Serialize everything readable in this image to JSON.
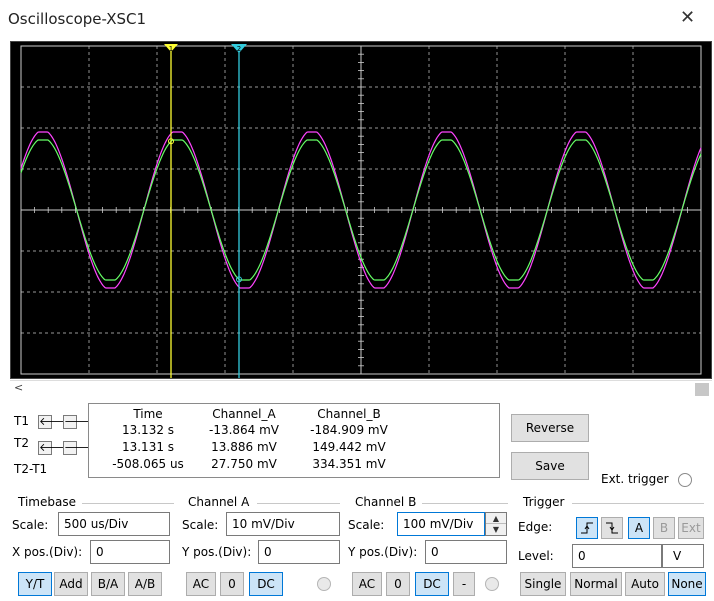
{
  "window": {
    "title": "Oscilloscope-XSC1",
    "close_glyph": "✕"
  },
  "cursors": {
    "t1_color": "#ffff33",
    "t2_color": "#33ccdd"
  },
  "traces": {
    "channel_a_color": "#66ff66",
    "channel_b_color": "#ff44ff",
    "grid_color": "#cccccc"
  },
  "scroll": {
    "left_glyph": "<"
  },
  "measurements": {
    "row_labels": [
      "T1",
      "T2",
      "T2-T1"
    ],
    "headers": [
      "Time",
      "Channel_A",
      "Channel_B"
    ],
    "rows": [
      [
        "13.132 s",
        "-13.864 mV",
        "-184.909 mV"
      ],
      [
        "13.131 s",
        "13.886 mV",
        "149.442 mV"
      ],
      [
        "-508.065 us",
        "27.750 mV",
        "334.351 mV"
      ]
    ],
    "arrow_left": "🡐",
    "arrow_right": "🡒"
  },
  "side_buttons": {
    "reverse": "Reverse",
    "save": "Save",
    "ext_trigger": "Ext. trigger"
  },
  "timebase": {
    "title": "Timebase",
    "scale_label": "Scale:",
    "scale_value": "500 us/Div",
    "xpos_label": "X pos.(Div):",
    "xpos_value": "0",
    "modes": [
      "Y/T",
      "Add",
      "B/A",
      "A/B"
    ]
  },
  "channel_a": {
    "title": "Channel A",
    "scale_label": "Scale:",
    "scale_value": "10 mV/Div",
    "ypos_label": "Y pos.(Div):",
    "ypos_value": "0",
    "coupling": [
      "AC",
      "0",
      "DC"
    ]
  },
  "channel_b": {
    "title": "Channel B",
    "scale_label": "Scale:",
    "scale_value": "100 mV/Div",
    "ypos_label": "Y pos.(Div):",
    "ypos_value": "0",
    "coupling": [
      "AC",
      "0",
      "DC",
      "-"
    ]
  },
  "trigger": {
    "title": "Trigger",
    "edge_label": "Edge:",
    "edge_buttons": [
      "A",
      "B",
      "Ext"
    ],
    "level_label": "Level:",
    "level_value": "0",
    "level_unit": "V",
    "modes": [
      "Single",
      "Normal",
      "Auto",
      "None"
    ]
  }
}
